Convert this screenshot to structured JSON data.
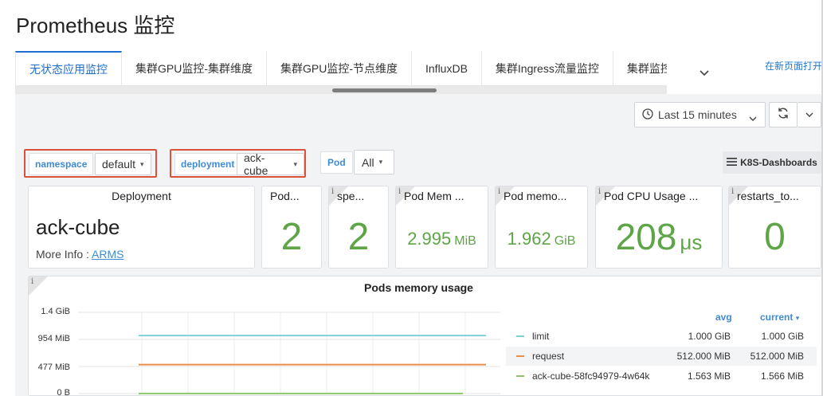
{
  "page": {
    "title": "Prometheus 监控",
    "open_new": "在新页面打开"
  },
  "tabs": [
    {
      "label": "无状态应用监控",
      "active": true
    },
    {
      "label": "集群GPU监控-集群维度"
    },
    {
      "label": "集群GPU监控-节点维度"
    },
    {
      "label": "InfluxDB"
    },
    {
      "label": "集群Ingress流量监控"
    },
    {
      "label": "集群监控概览"
    }
  ],
  "toolbar": {
    "time_range": "Last 15 minutes",
    "dashboards_link": "K8S-Dashboards"
  },
  "variables": {
    "namespace": {
      "label": "namespace",
      "value": "default"
    },
    "deployment": {
      "label": "deployment",
      "value": "ack-cube"
    },
    "pod": {
      "label": "Pod",
      "value": "All"
    }
  },
  "panels": {
    "deployment": {
      "title": "Deployment",
      "name": "ack-cube",
      "more_info_label": "More Info : ",
      "more_info_link": "ARMS"
    },
    "pods": {
      "title": "Pod...",
      "value": "2"
    },
    "spec": {
      "title": "spe...",
      "value": "2"
    },
    "pod_mem": {
      "title": "Pod Mem ...",
      "value": "2.995",
      "unit": "MiB"
    },
    "pod_memory": {
      "title": "Pod memo...",
      "value": "1.962",
      "unit": "GiB"
    },
    "pod_cpu": {
      "title": "Pod CPU Usage ...",
      "value": "208",
      "unit": "μs"
    },
    "restarts": {
      "title": "restarts_to...",
      "value": "0"
    }
  },
  "graph": {
    "title": "Pods memory usage",
    "y_ticks": [
      "1.4 GiB",
      "954 MiB",
      "477 MiB",
      "0 B"
    ],
    "legend_headers": {
      "avg": "avg",
      "current": "current"
    },
    "series": [
      {
        "name": "limit",
        "color": "#7ecfd8",
        "avg": "1.000 GiB",
        "current": "1.000 GiB",
        "level": 1.0
      },
      {
        "name": "request",
        "color": "#e8904a",
        "avg": "512.000 MiB",
        "current": "512.000 MiB",
        "level": 0.5
      },
      {
        "name": "ack-cube-58fc94979-4w64k",
        "color": "#8fc46e",
        "avg": "1.563 MiB",
        "current": "1.566 MiB",
        "level": 0.0015
      }
    ]
  }
}
